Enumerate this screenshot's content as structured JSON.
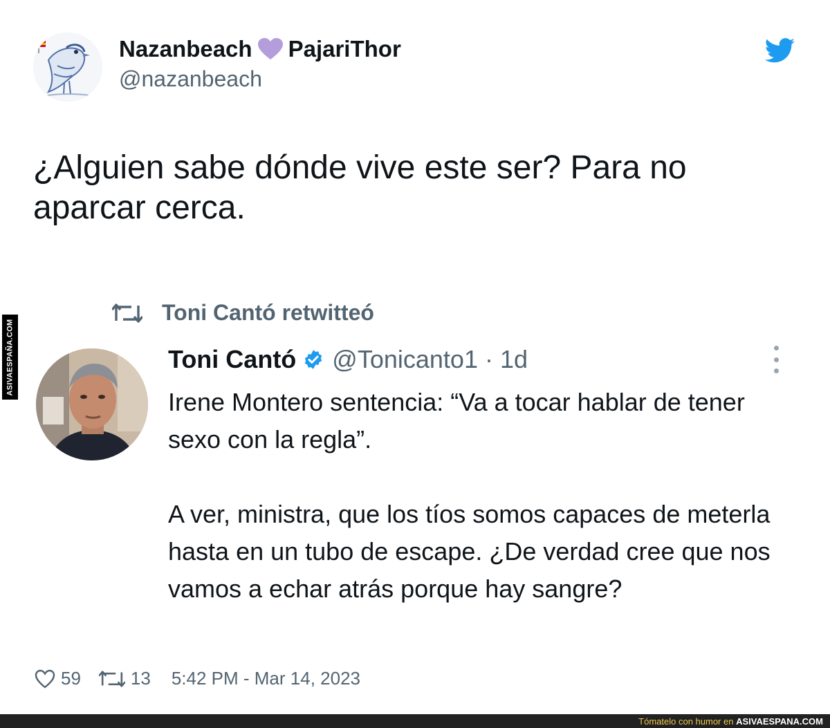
{
  "tweet": {
    "author": {
      "name_part1": "Nazanbeach",
      "name_emoji": "purple-heart-icon",
      "name_part2": "PajariThor",
      "handle": "@nazanbeach"
    },
    "text": "¿Alguien sabe dónde vive este ser? Para no aparcar cerca.",
    "likes": "59",
    "retweets": "13",
    "timestamp": "5:42 PM - Mar 14, 2023"
  },
  "retweet_banner": {
    "label": "Toni Cantó retwitteó"
  },
  "quoted": {
    "author_name": "Toni Cantó",
    "handle_time": "@Tonicanto1 · 1d",
    "text": "Irene Montero sentencia: “Va a tocar hablar de tener sexo con la regla”.\n\nA ver, ministra, que los tíos somos capaces de meterla hasta en un tubo de escape. ¿De verdad cree que nos vamos a echar atrás porque hay sangre?"
  },
  "watermark": {
    "side_text": "ASIVAESPAÑA.COM",
    "bottom_phrase": "Tómatelo con humor en",
    "bottom_brand": "ASIVAESPANA.COM"
  },
  "colors": {
    "twitter_blue": "#1d9bf0",
    "purple_heart": "#b39ddb",
    "secondary_text": "#536471"
  }
}
